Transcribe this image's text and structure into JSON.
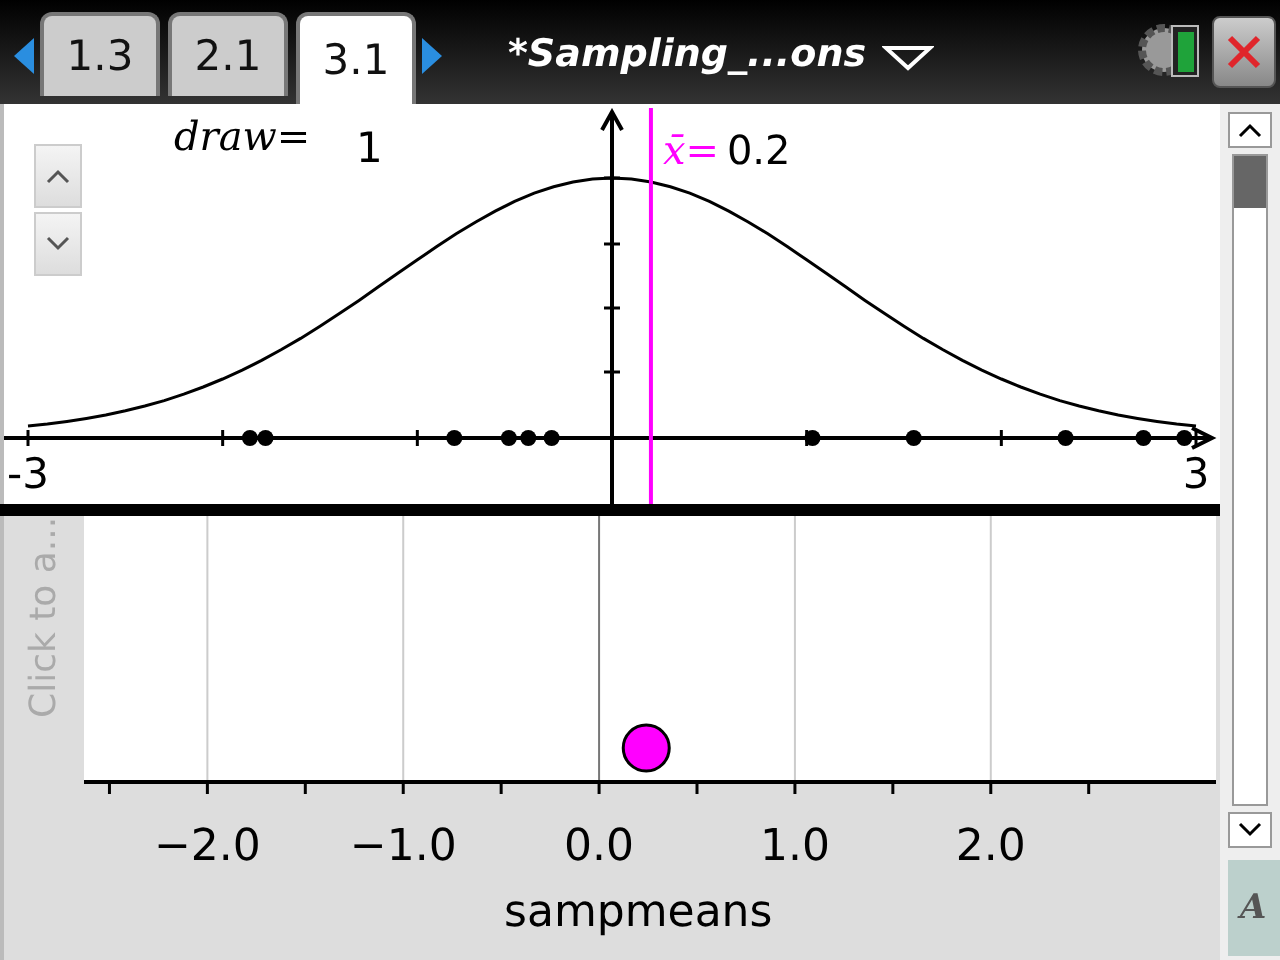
{
  "header": {
    "tabs": [
      {
        "label": "1.3",
        "selected": false
      },
      {
        "label": "2.1",
        "selected": false
      },
      {
        "label": "3.1",
        "selected": true
      }
    ],
    "title": "*Sampling_...ons"
  },
  "graph": {
    "slider": {
      "variable": "draw=",
      "value": "1"
    },
    "axis_labels": [
      "-3",
      "3"
    ],
    "mean_label": "x̄=",
    "mean_value": "0.2"
  },
  "dotplot": {
    "y_prompt": "Click to a...",
    "tick_labels": [
      "−2.0",
      "−1.0",
      "0.0",
      "1.0",
      "2.0"
    ],
    "xlabel": "sampmeans"
  },
  "side_label": "A"
}
